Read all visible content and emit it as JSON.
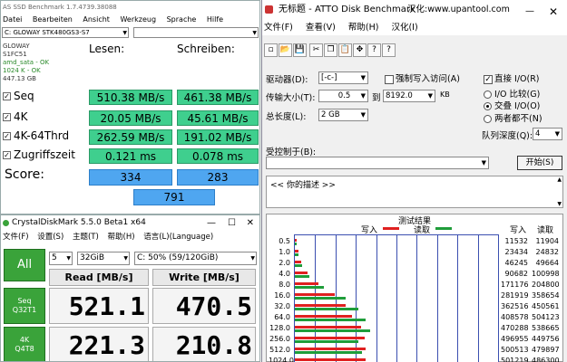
{
  "asssd": {
    "title": "AS SSD Benchmark 1.7.4739.38088",
    "menu": [
      "Datei",
      "Bearbeiten",
      "Ansicht",
      "Werkzeug",
      "Sprache",
      "Hilfe"
    ],
    "drive_select": "C: GLOWAY STK480GS3-S7",
    "info": [
      "GLOWAY",
      "S1FC51",
      "amd_sata - OK",
      "1024 K - OK",
      "447.13 GB"
    ],
    "col_read": "Lesen:",
    "col_write": "Schreiben:",
    "rows": [
      {
        "label": "Seq",
        "read": "510.38 MB/s",
        "write": "461.38 MB/s"
      },
      {
        "label": "4K",
        "read": "20.05 MB/s",
        "write": "45.61 MB/s"
      },
      {
        "label": "4K-64Thrd",
        "read": "262.59 MB/s",
        "write": "191.02 MB/s"
      },
      {
        "label": "Zugriffszeit",
        "read": "0.121 ms",
        "write": "0.078 ms"
      }
    ],
    "score_label": "Score:",
    "score_read": "334",
    "score_write": "283",
    "score_total": "791"
  },
  "cdm": {
    "title": "CrystalDiskMark 5.5.0 Beta1 x64",
    "menu": [
      "文件(F)",
      "设置(S)",
      "主题(T)",
      "帮助(H)",
      "语言(L)(Language)"
    ],
    "all_label": "All",
    "count": "5",
    "size": "32GiB",
    "drive": "C: 50% (59/120GiB)",
    "read_header": "Read [MB/s]",
    "write_header": "Write [MB/s]",
    "rows": [
      {
        "l1": "Seq",
        "l2": "Q32T1",
        "read": "521.1",
        "write": "470.5"
      },
      {
        "l1": "4K",
        "l2": "Q4T8",
        "read": "221.3",
        "write": "210.8"
      }
    ]
  },
  "atto": {
    "title": "无标题 - ATTO Disk Benchmark",
    "url": "汉化:www.upantool.com",
    "menu": [
      "文件(F)",
      "查看(V)",
      "帮助(H)",
      "汉化(I)"
    ],
    "drive_label": "驱动器(D):",
    "drive_value": "[-c-]",
    "force_label": "强制写入访问(A)",
    "direct_label": "直接 I/O(R)",
    "transfer_label": "传输大小(T):",
    "transfer_from": "0.5",
    "transfer_to_label": "到",
    "transfer_to": "8192.0",
    "kb": "KB",
    "total_label": "总长度(L):",
    "total_value": "2 GB",
    "io_compare": "I/O 比较(G)",
    "overlap": "交叠 I/O(O)",
    "neither": "两者都不(N)",
    "queue_label": "队列深度(Q):",
    "queue_value": "4",
    "control_label": "受控制于(B):",
    "start_button": "开始(S)",
    "description": "<<  你的描述  >>",
    "results_title": "测试结果",
    "legend_write": "写入",
    "legend_read": "读取",
    "col_write": "写入",
    "col_read": "读取",
    "colors": {
      "write": "#e02020",
      "read": "#1f9d3a",
      "grid": "#3b4fb0"
    },
    "results": [
      {
        "size": "0.5",
        "write": "11532",
        "read": "11904",
        "w": 0.008,
        "r": 0.008
      },
      {
        "size": "1.0",
        "write": "23434",
        "read": "24832",
        "w": 0.016,
        "r": 0.017
      },
      {
        "size": "2.0",
        "write": "46245",
        "read": "49664",
        "w": 0.032,
        "r": 0.034
      },
      {
        "size": "4.0",
        "write": "90682",
        "read": "100998",
        "w": 0.063,
        "r": 0.07
      },
      {
        "size": "8.0",
        "write": "171176",
        "read": "204800",
        "w": 0.118,
        "r": 0.141
      },
      {
        "size": "16.0",
        "write": "281919",
        "read": "358654",
        "w": 0.195,
        "r": 0.248
      },
      {
        "size": "32.0",
        "write": "362516",
        "read": "450561",
        "w": 0.25,
        "r": 0.311
      },
      {
        "size": "64.0",
        "write": "408578",
        "read": "504123",
        "w": 0.282,
        "r": 0.348
      },
      {
        "size": "128.0",
        "write": "470288",
        "read": "538665",
        "w": 0.325,
        "r": 0.372
      },
      {
        "size": "256.0",
        "write": "496955",
        "read": "449756",
        "w": 0.343,
        "r": 0.311
      },
      {
        "size": "512.0",
        "write": "500513",
        "read": "479897",
        "w": 0.346,
        "r": 0.331
      },
      {
        "size": "1024.0",
        "write": "501219",
        "read": "486300",
        "w": 0.346,
        "r": 0.336
      }
    ]
  }
}
